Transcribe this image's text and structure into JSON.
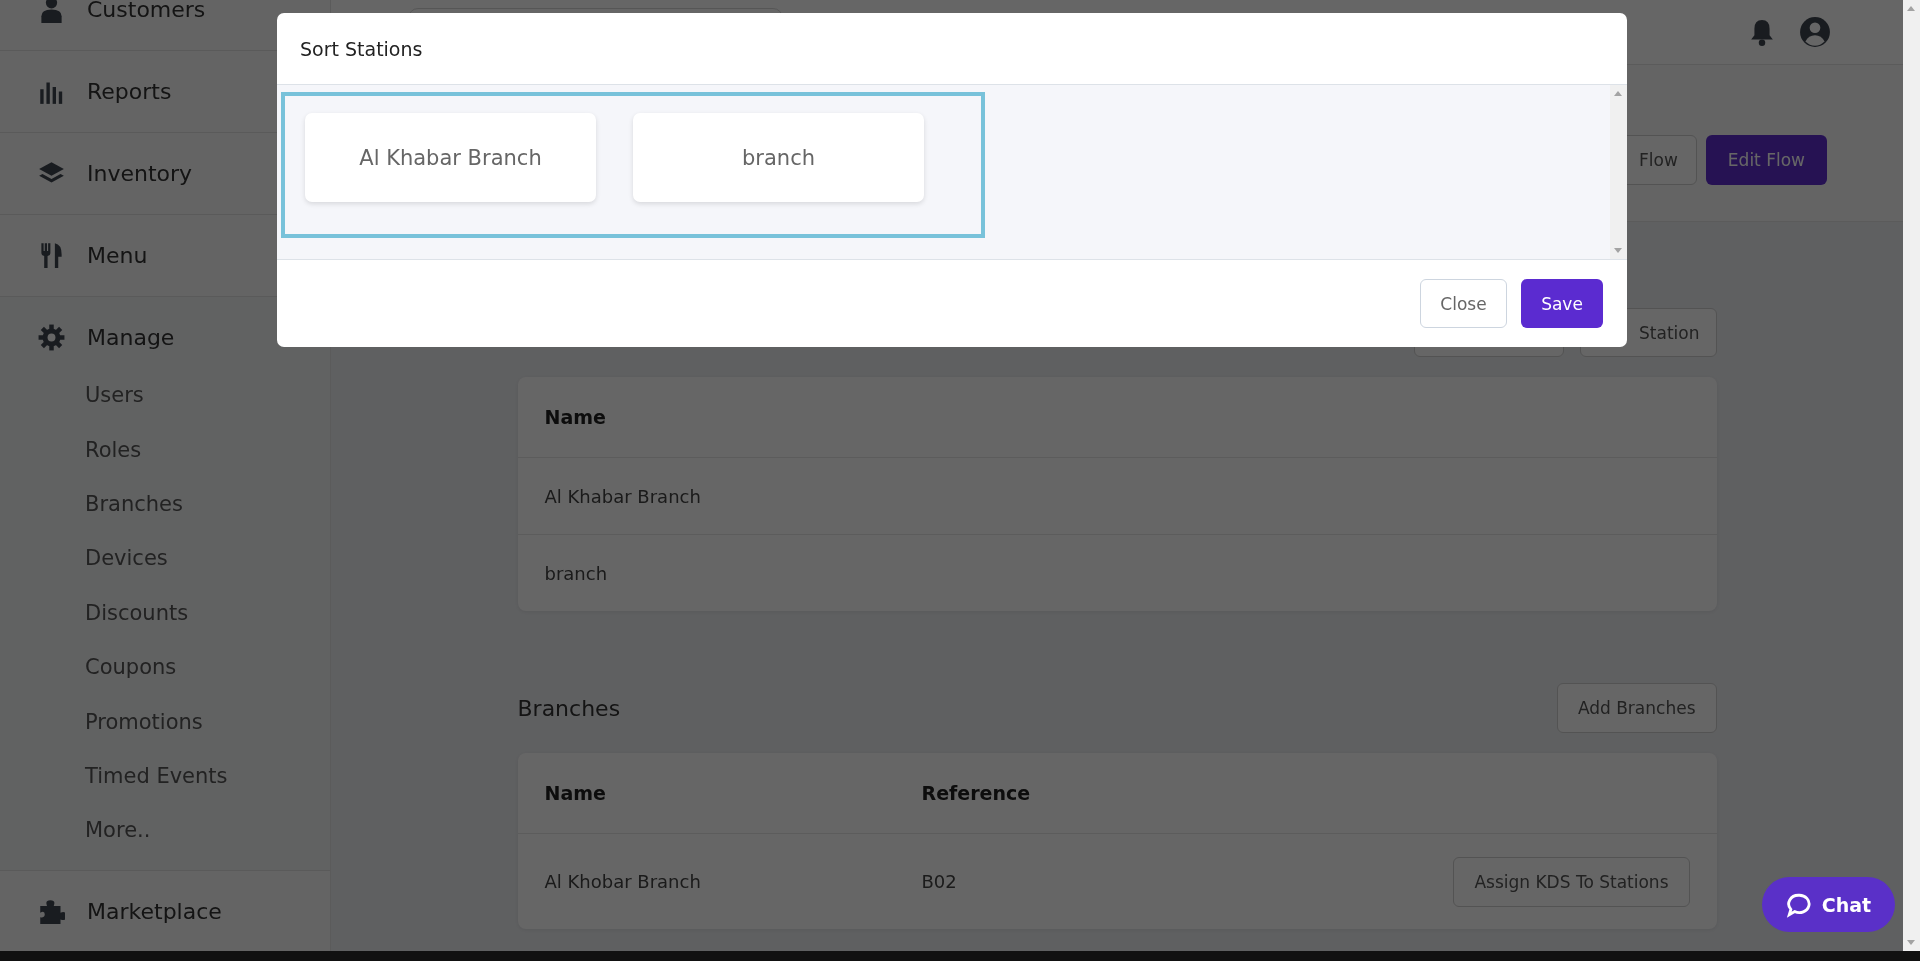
{
  "sidebar": {
    "items": [
      {
        "label": "Customers"
      },
      {
        "label": "Reports"
      },
      {
        "label": "Inventory"
      },
      {
        "label": "Menu"
      },
      {
        "label": "Manage",
        "children": [
          {
            "label": "Users"
          },
          {
            "label": "Roles"
          },
          {
            "label": "Branches"
          },
          {
            "label": "Devices"
          },
          {
            "label": "Discounts"
          },
          {
            "label": "Coupons"
          },
          {
            "label": "Promotions"
          },
          {
            "label": "Timed Events"
          },
          {
            "label": "More.."
          }
        ]
      },
      {
        "label": "Marketplace"
      }
    ]
  },
  "header_actions": [
    {
      "label": "Flow",
      "primary": false
    },
    {
      "label": "Edit Flow",
      "primary": true
    }
  ],
  "stations": {
    "buttons": [
      {
        "label": "Station"
      }
    ],
    "table": {
      "columns": [
        "Name"
      ],
      "rows": [
        [
          "Al Khabar Branch"
        ],
        [
          "branch"
        ]
      ]
    }
  },
  "branches": {
    "title": "Branches",
    "add_button": "Add Branches",
    "table": {
      "columns": [
        "Name",
        "Reference"
      ],
      "rows": [
        {
          "cells": [
            "Al Khobar Branch",
            "B02"
          ],
          "action": "Assign KDS To Stations"
        }
      ]
    }
  },
  "modal": {
    "title": "Sort Stations",
    "cards": [
      "Al Khabar Branch",
      "branch"
    ],
    "buttons": [
      {
        "label": "Close",
        "primary": false
      },
      {
        "label": "Save",
        "primary": true
      }
    ]
  },
  "chat": {
    "label": "Chat"
  }
}
